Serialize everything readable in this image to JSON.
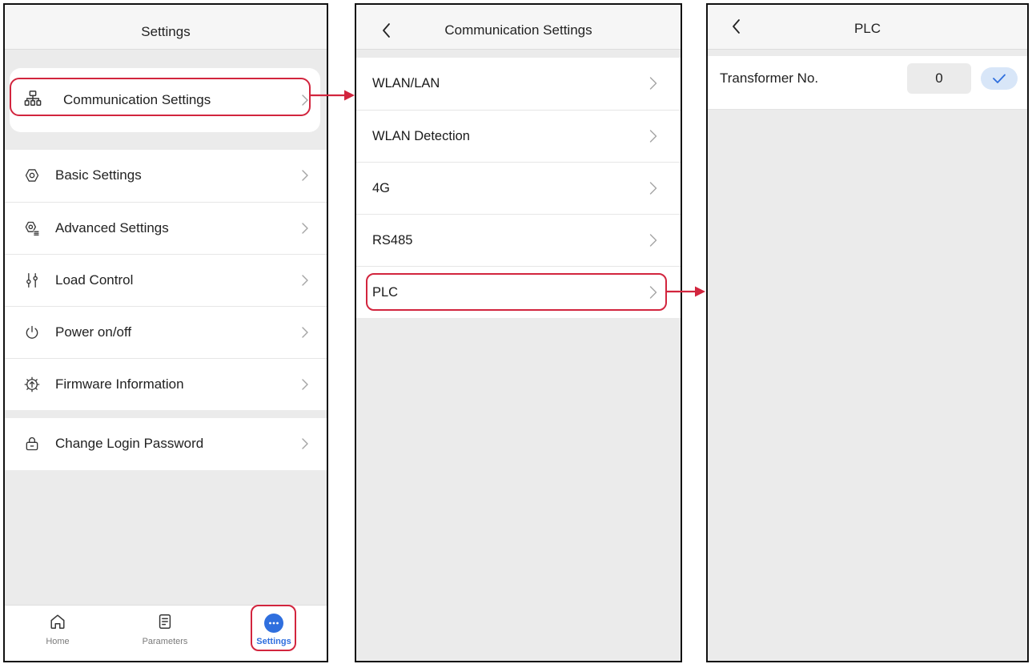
{
  "colors": {
    "accent": "#2f6fde",
    "highlight": "#d2253e",
    "page_bg": "#ebebeb",
    "header_bg": "#f6f6f6",
    "check_button_bg": "#d8e6f8"
  },
  "settings_screen": {
    "title": "Settings",
    "featured_item": {
      "label": "Communication Settings",
      "icon": "network-icon"
    },
    "menu_group_1": [
      {
        "label": "Basic Settings",
        "icon": "gear-icon"
      },
      {
        "label": "Advanced Settings",
        "icon": "gear-list-icon"
      },
      {
        "label": "Load Control",
        "icon": "sliders-icon"
      },
      {
        "label": "Power on/off",
        "icon": "power-icon"
      },
      {
        "label": "Firmware Information",
        "icon": "firmware-icon"
      }
    ],
    "menu_group_2": [
      {
        "label": "Change Login Password",
        "icon": "lock-icon"
      }
    ],
    "tab_bar": [
      {
        "label": "Home",
        "icon": "home-icon",
        "active": false
      },
      {
        "label": "Parameters",
        "icon": "document-icon",
        "active": false
      },
      {
        "label": "Settings",
        "icon": "more-icon",
        "active": true
      }
    ]
  },
  "communication_screen": {
    "title": "Communication Settings",
    "back_icon": "chevron-left-icon",
    "items": [
      {
        "label": "WLAN/LAN"
      },
      {
        "label": "WLAN Detection"
      },
      {
        "label": "4G"
      },
      {
        "label": "RS485"
      },
      {
        "label": "PLC"
      }
    ]
  },
  "plc_screen": {
    "title": "PLC",
    "back_icon": "chevron-left-icon",
    "field": {
      "label": "Transformer No.",
      "value": "0",
      "confirm_icon": "check-icon"
    }
  }
}
